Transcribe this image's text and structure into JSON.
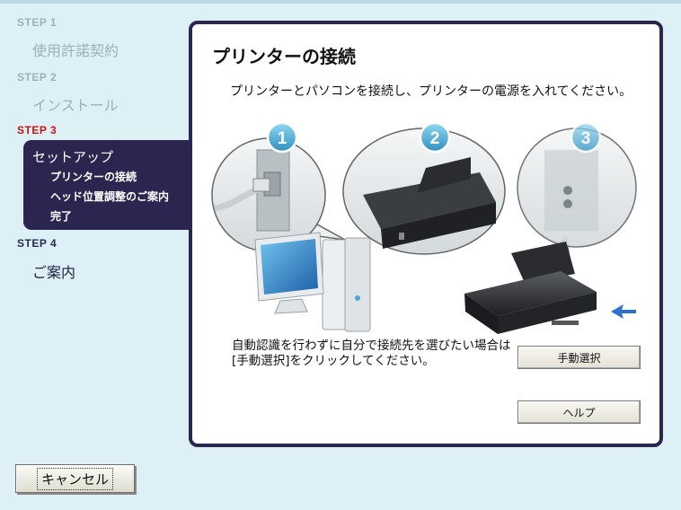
{
  "sidebar": {
    "step1": {
      "label": "STEP 1",
      "title": "使用許諾契約"
    },
    "step2": {
      "label": "STEP 2",
      "title": "インストール"
    },
    "step3": {
      "label": "STEP 3",
      "title": "セットアップ",
      "items": [
        "プリンターの接続",
        "ヘッド位置調整のご案内",
        "完了"
      ]
    },
    "step4": {
      "label": "STEP 4",
      "title": "ご案内"
    }
  },
  "main": {
    "heading": "プリンターの接続",
    "instruction": "プリンターとパソコンを接続し、プリンターの電源を入れてください。",
    "illustration": {
      "steps": [
        "1",
        "2",
        "3"
      ]
    },
    "manual_text": "自動認識を行わずに自分で接続先を選びたい場合は[手動選択]をクリックしてください。",
    "manual_button": "手動選択",
    "help_button": "ヘルプ"
  },
  "footer": {
    "cancel_button": "キャンセル"
  },
  "colors": {
    "background": "#dcf0f6",
    "accent": "#2b2650",
    "active_step": "#cc1010",
    "inactive_step": "#9fb0b8"
  }
}
